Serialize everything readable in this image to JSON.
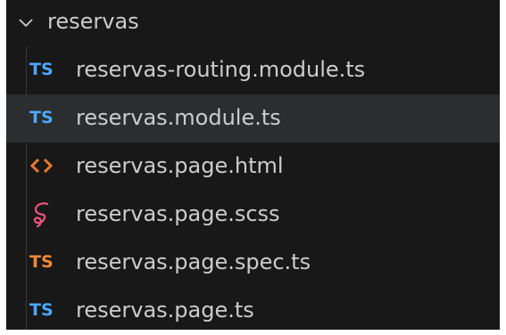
{
  "folder": {
    "label": "reservas",
    "icon": "chevron-down-icon"
  },
  "files": [
    {
      "label": "reservas-routing.module.ts",
      "icon_text": "TS",
      "icon": "typescript-icon",
      "color": "#4aa8ff",
      "selected": false
    },
    {
      "label": "reservas.module.ts",
      "icon_text": "TS",
      "icon": "typescript-icon",
      "color": "#4aa8ff",
      "selected": true
    },
    {
      "label": "reservas.page.html",
      "icon_text": "<>",
      "icon": "html-icon",
      "color": "#e37933",
      "selected": false
    },
    {
      "label": "reservas.page.scss",
      "icon_text": "",
      "icon": "sass-icon",
      "color": "#f55385",
      "selected": false
    },
    {
      "label": "reservas.page.spec.ts",
      "icon_text": "TS",
      "icon": "typescript-test-icon",
      "color": "#f18a38",
      "selected": false
    },
    {
      "label": "reservas.page.ts",
      "icon_text": "TS",
      "icon": "typescript-icon",
      "color": "#4aa8ff",
      "selected": false
    }
  ]
}
